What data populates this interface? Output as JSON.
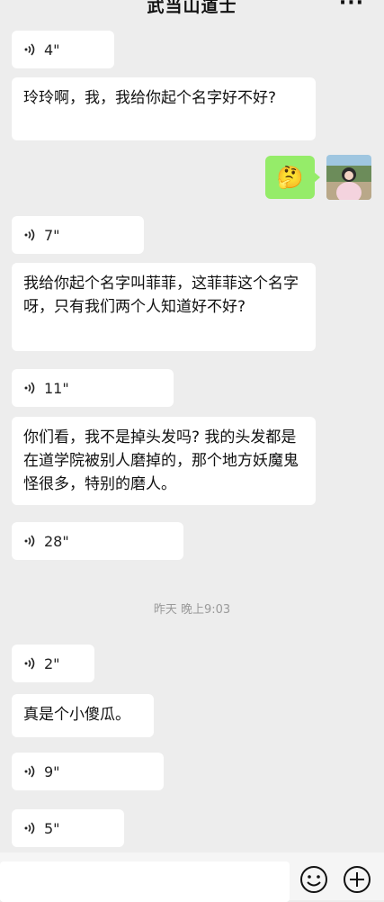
{
  "header": {
    "title": "武当山道士",
    "more_label": "···"
  },
  "messages": [
    {
      "type": "voice",
      "duration": "4\""
    },
    {
      "type": "text",
      "text": "玲玲啊，我，我给你起个名字好不好?"
    },
    {
      "type": "outgoing_emoji",
      "emoji": "🤔"
    },
    {
      "type": "voice",
      "duration": "7\""
    },
    {
      "type": "text",
      "text": "我给你起个名字叫菲菲，这菲菲这个名字呀，只有我们两个人知道好不好?"
    },
    {
      "type": "voice",
      "duration": "11\""
    },
    {
      "type": "text",
      "text": "你们看，我不是掉头发吗? 我的头发都是在道学院被别人磨掉的，那个地方妖魔鬼怪很多，特别的磨人。"
    },
    {
      "type": "voice",
      "duration": "28\""
    },
    {
      "type": "voice",
      "duration": "2\""
    },
    {
      "type": "text",
      "text": "真是个小傻瓜。"
    },
    {
      "type": "voice",
      "duration": "9\""
    },
    {
      "type": "voice",
      "duration": "5\""
    }
  ],
  "time_separator": "昨天 晚上9:03",
  "input": {
    "placeholder": ""
  },
  "icons": {
    "voice": "sound-wave-icon",
    "emoji": "smiley-face-icon",
    "plus": "plus-circle-icon",
    "more": "more-dots-icon"
  },
  "colors": {
    "background": "#ededed",
    "incoming_bubble": "#ffffff",
    "outgoing_bubble": "#95ec69"
  }
}
